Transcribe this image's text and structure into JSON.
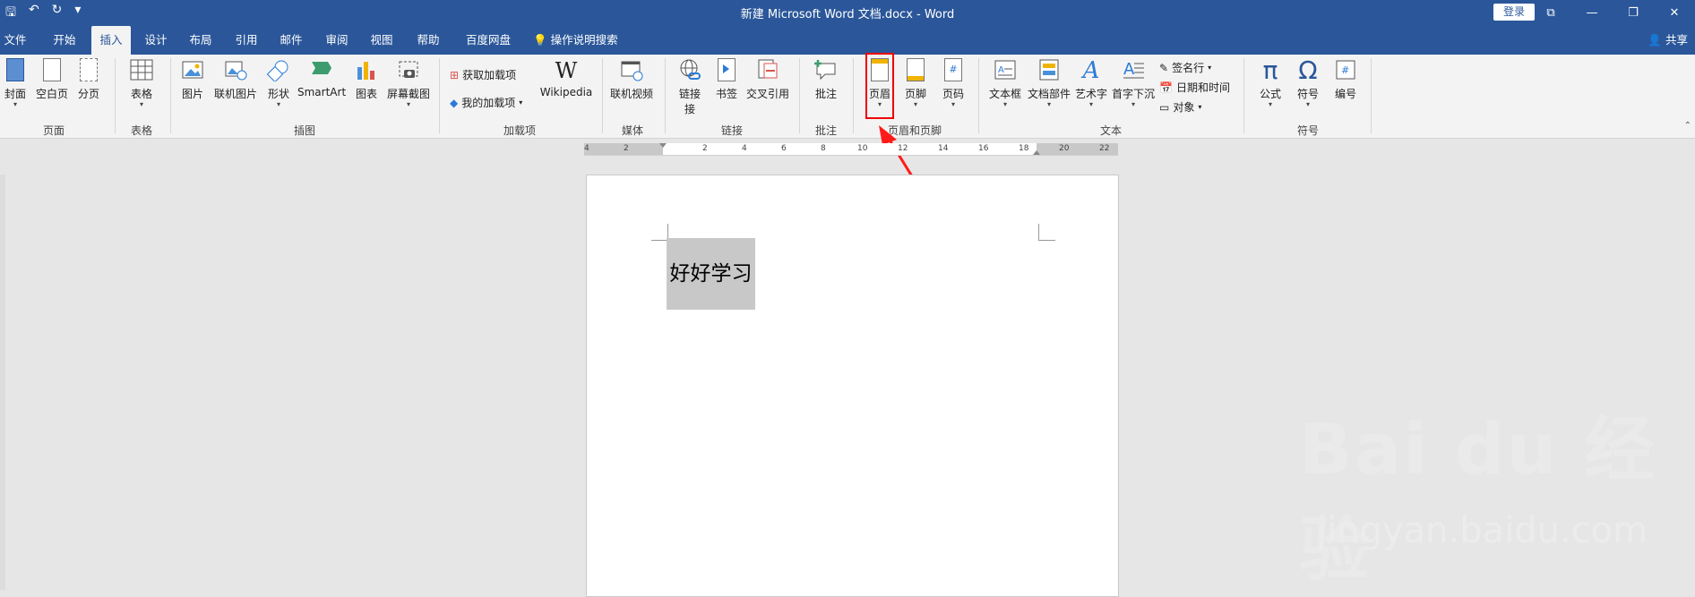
{
  "window": {
    "title": "新建 Microsoft Word 文档.docx  -  Word",
    "login_label": "登录",
    "qat": {
      "save": "🖫",
      "undo": "↶",
      "redo": "↻",
      "customize": "▾"
    },
    "controls": {
      "restore_ribbon": "⧉",
      "minimize": "—",
      "maximize": "❐",
      "close": "✕"
    }
  },
  "tabs": [
    "文件",
    "开始",
    "插入",
    "设计",
    "布局",
    "引用",
    "邮件",
    "审阅",
    "视图",
    "帮助",
    "百度网盘"
  ],
  "active_tab": "插入",
  "tell_me": "操作说明搜索",
  "share": "共享",
  "ribbon": {
    "groups": {
      "pages": "页面",
      "tables": "表格",
      "illustrations": "插图",
      "addins": "加载项",
      "media": "媒体",
      "links": "链接",
      "comments": "批注",
      "header_footer": "页眉和页脚",
      "text": "文本",
      "symbols": "符号"
    },
    "buttons": {
      "cover": "封面",
      "blank_page": "空白页",
      "page_break": "分页",
      "table": "表格",
      "picture": "图片",
      "online_picture": "联机图片",
      "shapes": "形状",
      "smartart": "SmartArt",
      "chart": "图表",
      "screenshot": "屏幕截图",
      "get_addins": "获取加载项",
      "my_addins": "我的加载项",
      "wikipedia": "Wikipedia",
      "online_video": "联机视频",
      "link": "链接",
      "link2": "接",
      "bookmark": "书签",
      "cross_ref": "交叉引用",
      "comment": "批注",
      "header": "页眉",
      "footer": "页脚",
      "page_number": "页码",
      "text_box": "文本框",
      "quick_parts": "文档部件",
      "wordart": "艺术字",
      "drop_cap": "首字下沉",
      "signature_line": "签名行",
      "date_time": "日期和时间",
      "object": "对象",
      "equation": "公式",
      "symbol": "符号",
      "numbering": "编号"
    }
  },
  "ruler_ticks": [
    "4",
    "2",
    "2",
    "4",
    "6",
    "8",
    "10",
    "12",
    "14",
    "16",
    "18",
    "20",
    "22"
  ],
  "document": {
    "text": "好好学习"
  },
  "watermark": {
    "main": "Bai du 经验",
    "sub": "jingyan.baidu.com"
  },
  "colors": {
    "title_bar": "#2b579a",
    "ribbon": "#f3f3f3",
    "highlight": "#e00000",
    "arrow": "#ff1a1a"
  }
}
